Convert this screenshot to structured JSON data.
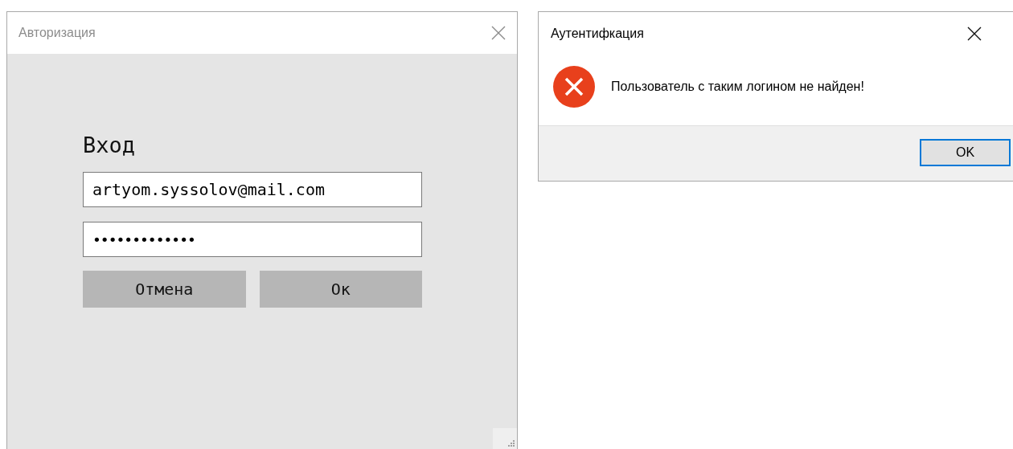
{
  "login_window": {
    "title": "Авторизация",
    "heading": "Вход",
    "fields": [
      {
        "kind": "text",
        "value": "artyom.syssolov@mail.com"
      },
      {
        "kind": "password",
        "value": "•••••••••••••"
      }
    ],
    "buttons": [
      {
        "label": "Отмена"
      },
      {
        "label": "Ок"
      }
    ]
  },
  "message_box": {
    "title": "Аутентифкация",
    "message": "Пользователь с таким логином не найден!",
    "buttons": [
      {
        "label": "OK",
        "selected": true
      }
    ]
  }
}
